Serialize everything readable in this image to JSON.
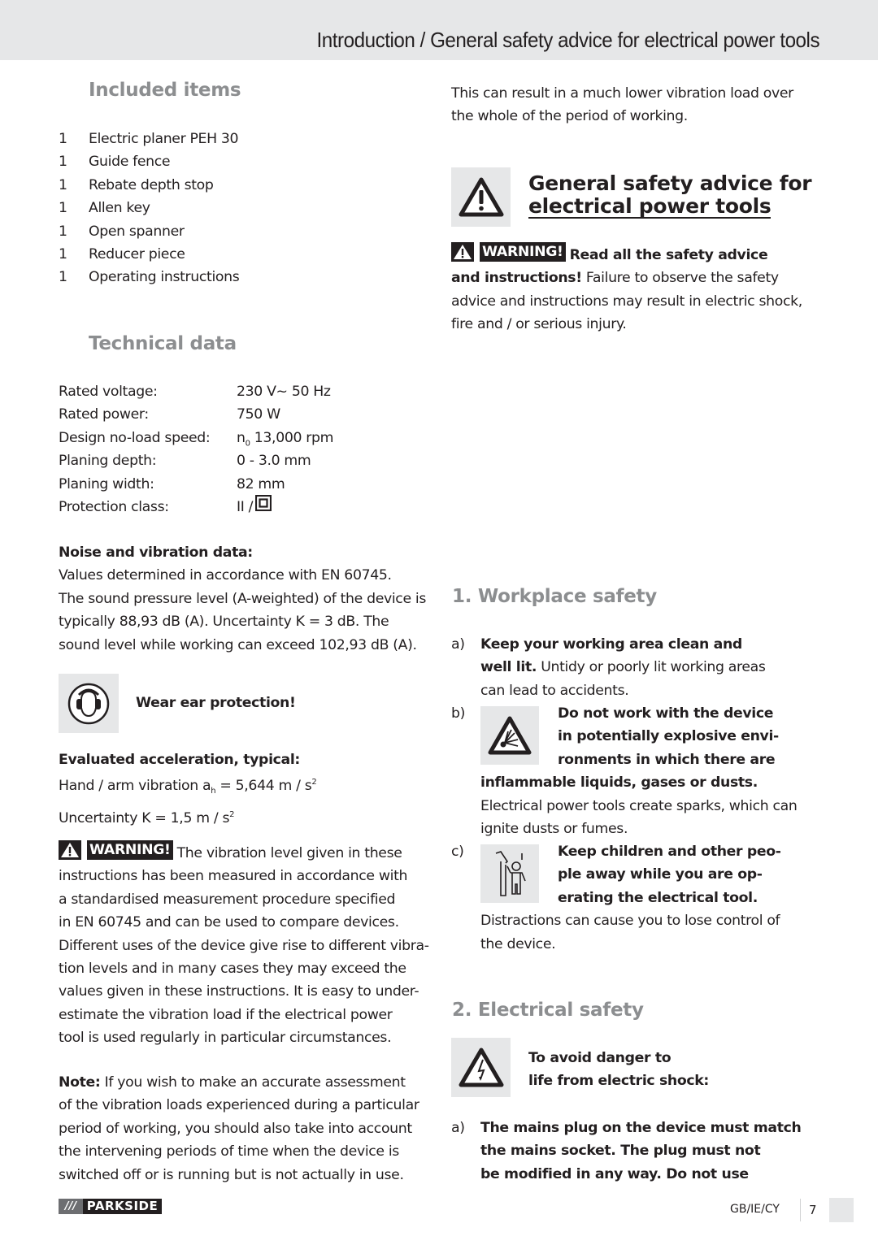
{
  "header": {
    "title": "Introduction / General safety advice for electrical power tools"
  },
  "included_items": {
    "heading": "Included items",
    "items": [
      {
        "qty": "1",
        "label": "Electric planer PEH 30"
      },
      {
        "qty": "1",
        "label": "Guide fence"
      },
      {
        "qty": "1",
        "label": "Rebate depth stop"
      },
      {
        "qty": "1",
        "label": "Allen key"
      },
      {
        "qty": "1",
        "label": "Open spanner"
      },
      {
        "qty": "1",
        "label": "Reducer piece"
      },
      {
        "qty": "1",
        "label": "Operating instructions"
      }
    ]
  },
  "technical_data": {
    "heading": "Technical data",
    "rows": [
      {
        "label": "Rated voltage:",
        "value": "230 V~ 50 Hz"
      },
      {
        "label": "Rated power:",
        "value": "750 W"
      },
      {
        "label": "Design no-load speed:",
        "value_prefix": "n",
        "value_sub": "0",
        "value": " 13,000 rpm"
      },
      {
        "label": "Planing depth:",
        "value": "0 - 3.0 mm"
      },
      {
        "label": "Planing width:",
        "value": "82 mm"
      },
      {
        "label": "Protection class:",
        "value": "II /"
      }
    ]
  },
  "noise": {
    "heading": "Noise and vibration data:",
    "lines": [
      "Values determined in accordance with EN 60745.",
      "The sound pressure level (A-weighted) of the device is",
      "typically 88,93 dB (A). Uncertainty K = 3 dB. The",
      "sound level while working can exceed 102,93 dB (A)."
    ]
  },
  "ear_protection": {
    "label": "Wear ear protection!",
    "icon": "ear-protection-icon"
  },
  "acceleration": {
    "heading": "Evaluated acceleration, typical:",
    "line1_a": "Hand / arm vibration a",
    "line1_sub": "h",
    "line1_b": " = 5,644 m / s",
    "line1_sup": "2",
    "line2_a": "Uncertainty K = 1,5 m / s",
    "line2_sup": "2"
  },
  "vibration_warning": {
    "badge": "WARNING!",
    "lines": [
      "The vibration level given in these",
      "instructions has been measured in accordance with",
      "a standardised measurement procedure specified",
      "in EN 60745 and can be used to compare devices.",
      "Different uses of the device give rise to different vibra-",
      "tion levels and in many cases they may exceed the",
      "values given in these instructions. It is easy to under-",
      "estimate the vibration load if the electrical power",
      "tool is used regularly in particular circumstances."
    ]
  },
  "note": {
    "label": "Note:",
    "lines": [
      "If you wish to make an accurate assessment",
      "of the vibration loads experienced during a particular",
      "period of working, you should also take into account",
      "the intervening periods of time when the device is",
      "switched off or is running but is not actually in use."
    ]
  },
  "right_intro": {
    "lines": [
      "This can result in a much lower vibration load over",
      "the whole of the period of working."
    ]
  },
  "general_safety": {
    "title_line1": "General safety advice for",
    "title_line2": "electrical power tools",
    "badge": "WARNING!",
    "bold_1": "Read all the safety advice",
    "bold_2": "and instructions!",
    "text_2": " Failure to observe the safety",
    "lines": [
      "advice and instructions may result in electric shock,",
      "fire and / or serious injury."
    ]
  },
  "workplace_safety": {
    "heading": "1. Workplace safety",
    "items": [
      {
        "letter": "a)",
        "bold_1": "Keep your working area clean and",
        "bold_2": "well lit.",
        "text_2": " Untidy or poorly lit working areas",
        "text_3": "can lead to accidents."
      },
      {
        "letter": "b)",
        "icon": "explosive-hazard-icon",
        "bold_lines": [
          "Do not work with the device",
          "in potentially explosive envi-",
          "ronments in which there are",
          "inflammable liquids, gases or dusts."
        ],
        "text_lines": [
          "Electrical power tools create sparks, which can",
          "ignite dusts or fumes."
        ]
      },
      {
        "letter": "c)",
        "icon": "keep-children-away-icon",
        "bold_lines": [
          "Keep children and other peo-",
          "ple away while you are op-",
          "erating the electrical tool."
        ],
        "text_lines": [
          "Distractions can cause you to lose control of",
          "the device."
        ]
      }
    ]
  },
  "electrical_safety": {
    "heading": "2. Electrical safety",
    "icon_caption_1": "To avoid danger to",
    "icon_caption_2": "life from electric shock:",
    "item_a": {
      "letter": "a)",
      "bold_lines": [
        "The mains plug on the device must match",
        "the mains socket. The plug must not",
        "be modified in any way. Do not use"
      ]
    }
  },
  "footer": {
    "brand_slashes": "///",
    "brand": "PARKSIDE",
    "region": "GB/IE/CY",
    "page": "7"
  }
}
